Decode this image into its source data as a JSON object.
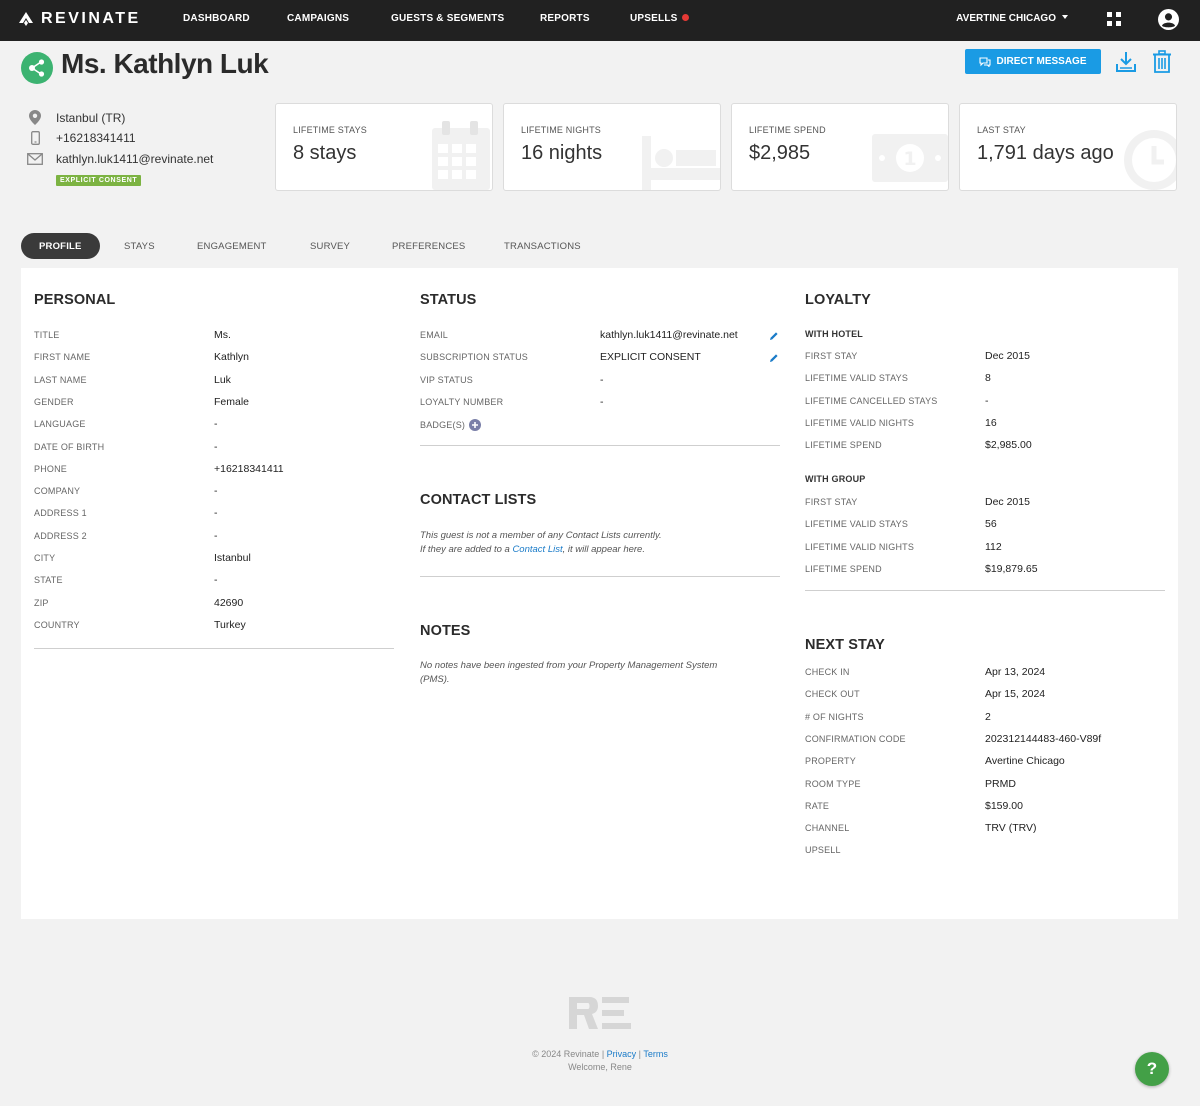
{
  "nav": {
    "brand": "REVINATE",
    "items": [
      "DASHBOARD",
      "CAMPAIGNS",
      "GUESTS & SEGMENTS",
      "REPORTS",
      "UPSELLS"
    ],
    "account": "AVERTINE CHICAGO"
  },
  "guest": {
    "name": "Ms. Kathlyn Luk",
    "location": "Istanbul (TR)",
    "phone": "+16218341411",
    "email": "kathlyn.luk1411@revinate.net",
    "consent_badge": "EXPLICIT CONSENT"
  },
  "actions": {
    "direct_message": "DIRECT MESSAGE"
  },
  "stats": [
    {
      "label": "LIFETIME STAYS",
      "value": "8 stays"
    },
    {
      "label": "LIFETIME NIGHTS",
      "value": "16 nights"
    },
    {
      "label": "LIFETIME SPEND",
      "value": "$2,985"
    },
    {
      "label": "LAST STAY",
      "value": "1,791 days ago"
    }
  ],
  "tabs": [
    "PROFILE",
    "STAYS",
    "ENGAGEMENT",
    "SURVEY",
    "PREFERENCES",
    "TRANSACTIONS"
  ],
  "personal": {
    "title": "PERSONAL",
    "rows": [
      {
        "label": "TITLE",
        "value": "Ms."
      },
      {
        "label": "FIRST NAME",
        "value": "Kathlyn"
      },
      {
        "label": "LAST NAME",
        "value": "Luk"
      },
      {
        "label": "GENDER",
        "value": "Female"
      },
      {
        "label": "LANGUAGE",
        "value": "-"
      },
      {
        "label": "DATE OF BIRTH",
        "value": "-"
      },
      {
        "label": "PHONE",
        "value": "+16218341411"
      },
      {
        "label": "COMPANY",
        "value": "-"
      },
      {
        "label": "ADDRESS 1",
        "value": "-"
      },
      {
        "label": "ADDRESS 2",
        "value": "-"
      },
      {
        "label": "CITY",
        "value": "Istanbul"
      },
      {
        "label": "STATE",
        "value": "-"
      },
      {
        "label": "ZIP",
        "value": "42690"
      },
      {
        "label": "COUNTRY",
        "value": "Turkey"
      }
    ]
  },
  "status": {
    "title": "STATUS",
    "rows": [
      {
        "label": "EMAIL",
        "value": "kathlyn.luk1411@revinate.net"
      },
      {
        "label": "SUBSCRIPTION STATUS",
        "value": "EXPLICIT CONSENT"
      },
      {
        "label": "VIP STATUS",
        "value": "-"
      },
      {
        "label": "LOYALTY NUMBER",
        "value": "-"
      }
    ],
    "badges_label": "BADGE(S)"
  },
  "contact_lists": {
    "title": "CONTACT LISTS",
    "note_line1": "This guest is not a member of any Contact Lists currently.",
    "note_line2_pre": "If they are added to a ",
    "note_line2_link": "Contact List",
    "note_line2_post": ", it will appear here."
  },
  "notes": {
    "title": "NOTES",
    "note_line1": "No notes have been ingested from your Property Management System",
    "note_line2": "(PMS)."
  },
  "loyalty": {
    "title": "LOYALTY",
    "with_hotel": {
      "heading": "WITH HOTEL",
      "rows": [
        {
          "label": "FIRST STAY",
          "value": "Dec 2015"
        },
        {
          "label": "LIFETIME VALID STAYS",
          "value": "8"
        },
        {
          "label": "LIFETIME CANCELLED STAYS",
          "value": "-"
        },
        {
          "label": "LIFETIME VALID NIGHTS",
          "value": "16"
        },
        {
          "label": "LIFETIME SPEND",
          "value": "$2,985.00"
        }
      ]
    },
    "with_group": {
      "heading": "WITH GROUP",
      "rows": [
        {
          "label": "FIRST STAY",
          "value": "Dec 2015"
        },
        {
          "label": "LIFETIME VALID STAYS",
          "value": "56"
        },
        {
          "label": "LIFETIME VALID NIGHTS",
          "value": "112"
        },
        {
          "label": "LIFETIME SPEND",
          "value": "$19,879.65"
        }
      ]
    }
  },
  "next_stay": {
    "title": "NEXT STAY",
    "rows": [
      {
        "label": "CHECK IN",
        "value": "Apr 13, 2024"
      },
      {
        "label": "CHECK OUT",
        "value": "Apr 15, 2024"
      },
      {
        "label": "# OF NIGHTS",
        "value": "2"
      },
      {
        "label": "CONFIRMATION CODE",
        "value": "202312144483-460-V89f"
      },
      {
        "label": "PROPERTY",
        "value": "Avertine Chicago"
      },
      {
        "label": "ROOM TYPE",
        "value": "PRMD"
      },
      {
        "label": "RATE",
        "value": "$159.00"
      },
      {
        "label": "CHANNEL",
        "value": "TRV (TRV)"
      },
      {
        "label": "UPSELL",
        "value": ""
      }
    ]
  },
  "footer": {
    "copyright": "© 2024 Revinate",
    "privacy": "Privacy",
    "terms": "Terms",
    "welcome": "Welcome, Rene",
    "help": "?"
  },
  "colors": {
    "nav_bg": "#212121",
    "primary": "#1a9be4",
    "consent_green": "#7cb342",
    "avatar_green": "#3cb371",
    "help_green": "#43a047",
    "alert_red": "#e53935"
  }
}
